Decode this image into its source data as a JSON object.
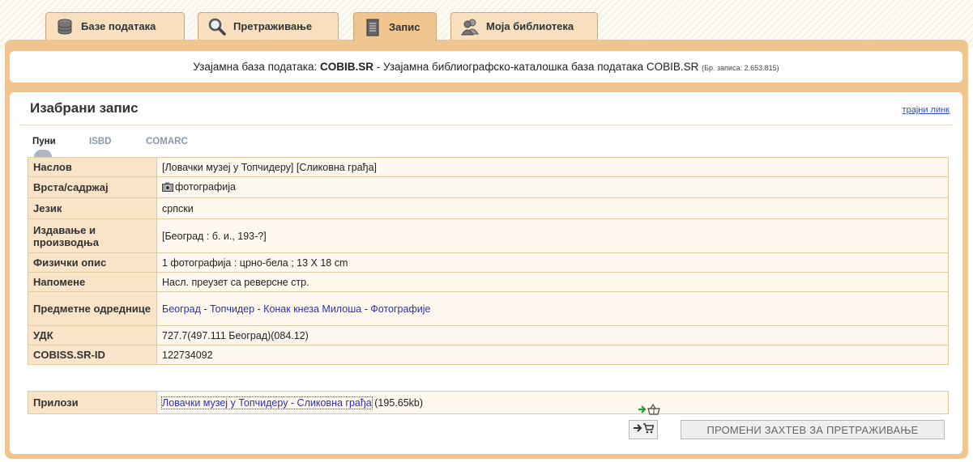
{
  "tabs": [
    {
      "label": "Базе података",
      "icon": "database-icon"
    },
    {
      "label": "Претраживање",
      "icon": "magnifier-icon"
    },
    {
      "label": "Запис",
      "icon": "document-icon"
    },
    {
      "label": "Моја библиотека",
      "icon": "users-icon"
    }
  ],
  "info": {
    "prefix": "Узајамна база података:",
    "db_code": "COBIB.SR",
    "separator": "-",
    "db_name": "Узајамна библиографско-каталошка база података COBIB.SR",
    "count": "(Бр. записа: 2.653.815)"
  },
  "record": {
    "title": "Изабрани запис",
    "permalink": "трајни линк",
    "subtabs": [
      "Пуни",
      "ISBD",
      "COMARC"
    ],
    "fields": {
      "title_label": "Наслов",
      "title_value": "[Ловачки музеј у Топчидеру] [Сликовна грађа]",
      "type_label": "Врста/садржај",
      "type_value": "фотографија",
      "lang_label": "Језик",
      "lang_value": "српски",
      "pub_label": "Издавање и производња",
      "pub_value": "[Београд : б. и., 193-?]",
      "phys_label": "Физички опис",
      "phys_value": "1 фотографија : црно-бела ; 13 X 18 cm",
      "notes_label": "Напомене",
      "notes_value": "Насл. преузет са реверсне стр.",
      "subj_label": "Предметне одреднице",
      "subjects": [
        "Београд",
        "Топчидер",
        "Конак кнеза Милоша",
        "Фотографије"
      ],
      "subj_sep": " - ",
      "udc_label": "УДК",
      "udc_value": "727.7(497.111 Београд)(084.12)",
      "id_label": "COBISS.SR-ID",
      "id_value": "122734092"
    },
    "attachments_label": "Прилози",
    "attachment_link": "Ловачки музеј у Топчидеру - Сликовна грађа",
    "attachment_size": "(195.65kb)"
  },
  "actions": {
    "change_search": "ПРОМЕНИ ЗАХТЕВ ЗА ПРЕТРАЖИВАЊЕ"
  }
}
